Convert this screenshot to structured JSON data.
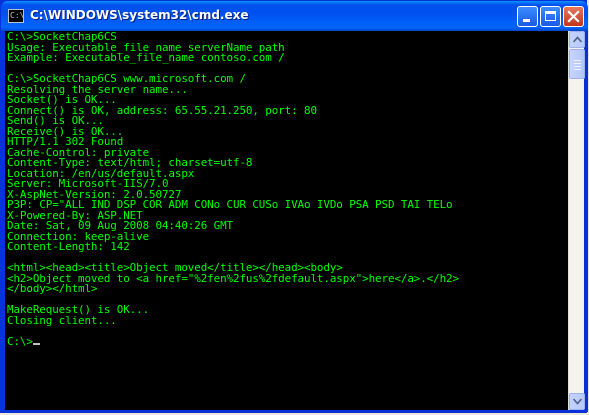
{
  "window": {
    "title": "C:\\WINDOWS\\system32\\cmd.exe",
    "icon_text": "C:\\"
  },
  "console": {
    "lines": [
      "C:\\>SocketChap6CS",
      "Usage: Executable_file_name serverName path",
      "Example: Executable_file_name contoso.com /",
      "",
      "C:\\>SocketChap6CS www.microsoft.com /",
      "Resolving the server name...",
      "Socket() is OK...",
      "Connect() is OK, address: 65.55.21.250, port: 80",
      "Send() is OK...",
      "Receive() is OK...",
      "HTTP/1.1 302 Found",
      "Cache-Control: private",
      "Content-Type: text/html; charset=utf-8",
      "Location: /en/us/default.aspx",
      "Server: Microsoft-IIS/7.0",
      "X-AspNet-Version: 2.0.50727",
      "P3P: CP=\"ALL IND DSP COR ADM CONo CUR CUSo IVAo IVDo PSA PSD TAI TELo",
      "X-Powered-By: ASP.NET",
      "Date: Sat, 09 Aug 2008 04:40:26 GMT",
      "Connection: keep-alive",
      "Content-Length: 142",
      "",
      "<html><head><title>Object moved</title></head><body>",
      "<h2>Object moved to <a href=\"%2fen%2fus%2fdefault.aspx\">here</a>.</h2>",
      "</body></html>",
      "",
      "MakeRequest() is OK...",
      "Closing client...",
      ""
    ],
    "prompt": "C:\\>"
  },
  "colors": {
    "console_bg": "#000000",
    "console_text": "#00ff00",
    "titlebar": "#0054e3"
  },
  "icons": {
    "minimize": "minimize-icon",
    "maximize": "maximize-icon",
    "close": "close-icon"
  }
}
